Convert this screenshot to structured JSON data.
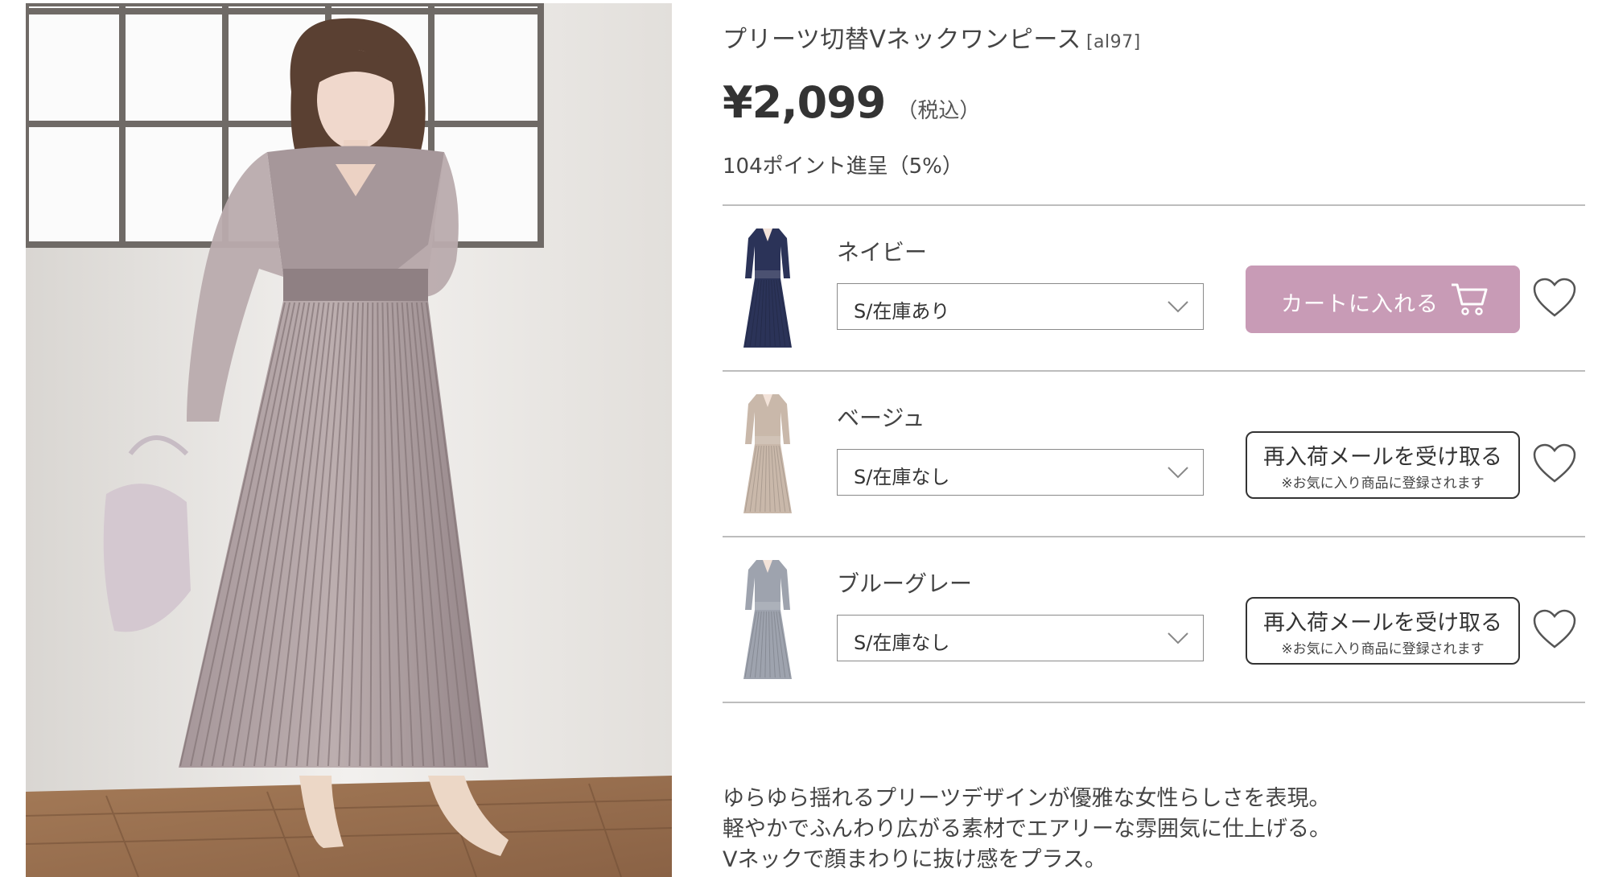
{
  "product": {
    "title": "プリーツ切替Vネックワンピース",
    "code": "[al97]",
    "price": "¥2,099",
    "tax_note": "（税込）",
    "points": "104ポイント進呈（5%）"
  },
  "variants": [
    {
      "color_name": "ネイビー",
      "selected_option": "S/在庫あり",
      "in_stock": true,
      "action_label": "カートに入れる",
      "thumb_color": "#2b3358"
    },
    {
      "color_name": "ベージュ",
      "selected_option": "S/在庫なし",
      "in_stock": false,
      "action_label": "再入荷メールを受け取る",
      "action_sub": "※お気に入り商品に登録されます",
      "thumb_color": "#c9b8aa"
    },
    {
      "color_name": "ブルーグレー",
      "selected_option": "S/在庫なし",
      "in_stock": false,
      "action_label": "再入荷メールを受け取る",
      "action_sub": "※お気に入り商品に登録されます",
      "thumb_color": "#9ea3ae"
    }
  ],
  "description": [
    "ゆらゆら揺れるプリーツデザインが優雅な女性らしさを表現。",
    "軽やかでふんわり広がる素材でエアリーな雰囲気に仕上げる。",
    "Vネックで顔まわりに抜け感をプラス。"
  ],
  "colors": {
    "cart_button": "#c89bb6",
    "divider": "#bdbdbd",
    "dress_main": "#9e8f8f"
  },
  "icons": {
    "cart": "cart-icon",
    "heart": "heart-icon",
    "chevron": "chevron-down-icon"
  }
}
